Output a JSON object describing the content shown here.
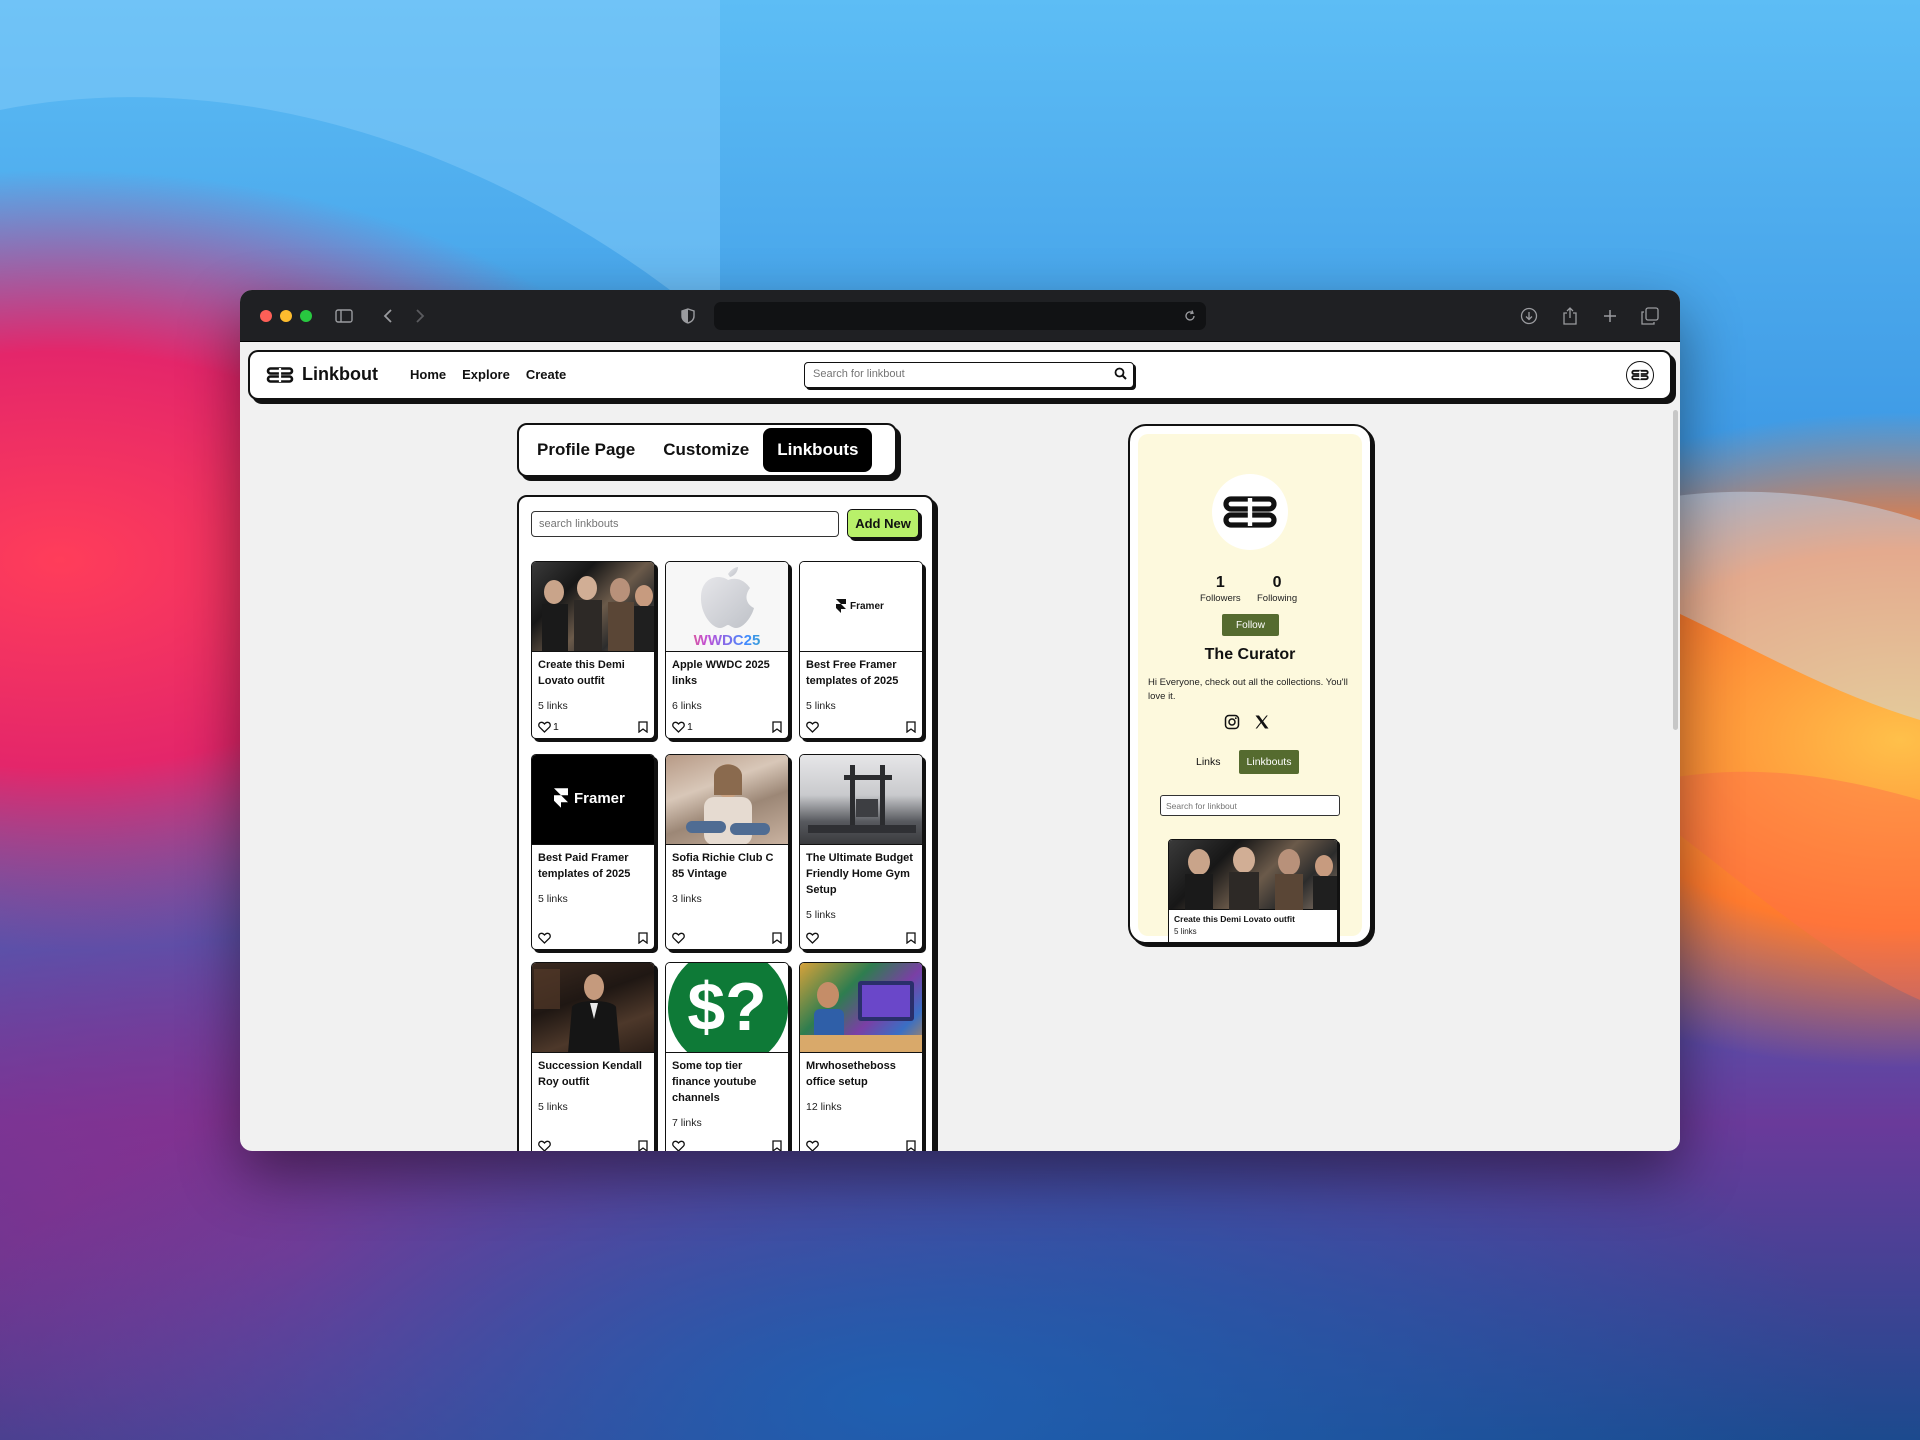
{
  "browser": {
    "url": ""
  },
  "nav": {
    "brand": "Linkbout",
    "links": [
      "Home",
      "Explore",
      "Create"
    ],
    "search_placeholder": "Search for linkbout"
  },
  "tabs": [
    {
      "label": "Profile Page",
      "active": false
    },
    {
      "label": "Customize",
      "active": false
    },
    {
      "label": "Linkbouts",
      "active": true
    }
  ],
  "panel": {
    "search_placeholder": "search linkbouts",
    "add_new": "Add New",
    "cards": [
      {
        "title": "Create this Demi Lovato outfit",
        "count": "5 links",
        "likes": "1",
        "thumb": "photo-group"
      },
      {
        "title": "Apple WWDC 2025 links",
        "count": "6 links",
        "likes": "1",
        "thumb": "apple-wwdc"
      },
      {
        "title": "Best Free Framer templates of 2025",
        "count": "5 links",
        "likes": "",
        "thumb": "framer-light"
      },
      {
        "title": "Best Paid Framer templates of 2025",
        "count": "5 links",
        "likes": "",
        "thumb": "framer-dark"
      },
      {
        "title": "Sofia Richie Club C 85 Vintage",
        "count": "3 links",
        "likes": "",
        "thumb": "photo-sofia"
      },
      {
        "title": "The Ultimate Budget Friendly Home Gym Setup",
        "count": "5 links",
        "likes": "",
        "thumb": "photo-gym"
      },
      {
        "title": "Succession Kendall Roy outfit",
        "count": "5 links",
        "likes": "",
        "thumb": "photo-suit"
      },
      {
        "title": "Some top tier finance youtube channels",
        "count": "7 links",
        "likes": "",
        "thumb": "dollar-question"
      },
      {
        "title": "Mrwhosetheboss office setup",
        "count": "12 links",
        "likes": "",
        "thumb": "photo-office"
      }
    ]
  },
  "thumb_text": {
    "wwdc": "WWDC25",
    "framer": "Framer",
    "dollar": "$?"
  },
  "preview": {
    "followers_count": "1",
    "followers_label": "Followers",
    "following_count": "0",
    "following_label": "Following",
    "follow_button": "Follow",
    "name": "The Curator",
    "bio": "Hi Everyone, check out all the collections. You'll love it.",
    "tabs": [
      "Links",
      "Linkbouts"
    ],
    "search_placeholder": "Search for linkbout",
    "card_title": "Create this Demi Lovato outfit",
    "card_count": "5 links"
  },
  "colors": {
    "accent_green": "#b8f06a",
    "olive": "#556b2f",
    "preview_bg": "#fdf9dd"
  }
}
